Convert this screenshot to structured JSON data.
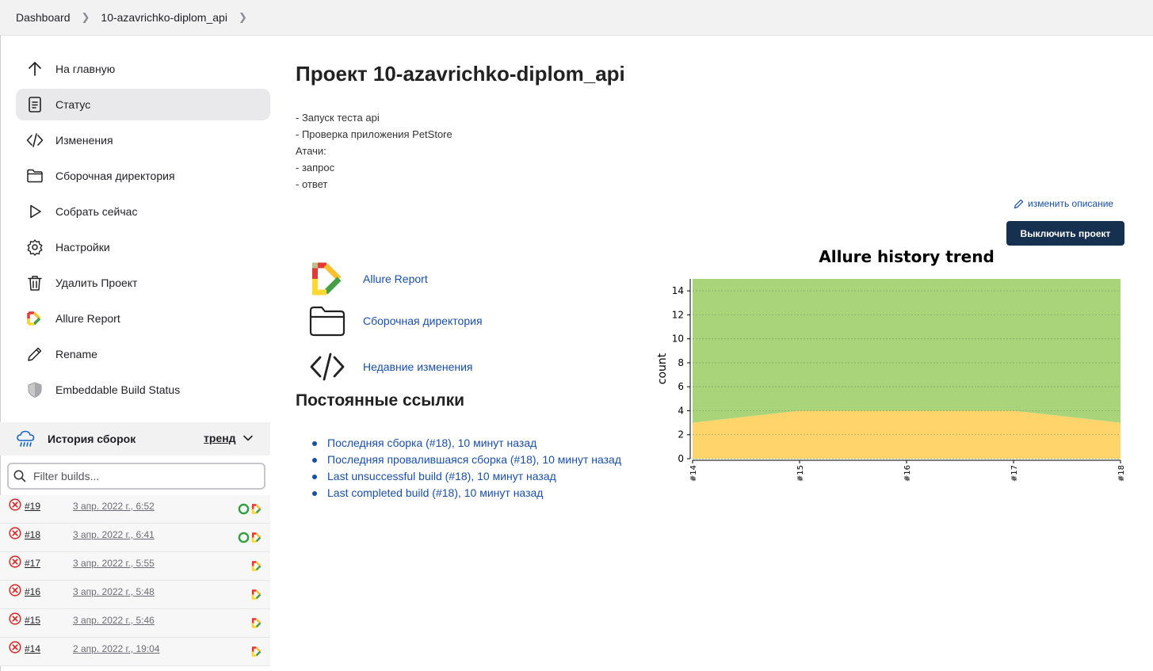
{
  "breadcrumb": [
    "Dashboard",
    "10-azavrichko-diplom_api"
  ],
  "sidebar": {
    "items": [
      {
        "label": "На главную",
        "icon": "arrow-up-icon",
        "active": false
      },
      {
        "label": "Статус",
        "icon": "document-icon",
        "active": true
      },
      {
        "label": "Изменения",
        "icon": "code-icon",
        "active": false
      },
      {
        "label": "Сборочная директория",
        "icon": "folder-icon",
        "active": false
      },
      {
        "label": "Собрать сейчас",
        "icon": "play-icon",
        "active": false
      },
      {
        "label": "Настройки",
        "icon": "gear-icon",
        "active": false
      },
      {
        "label": "Удалить Проект",
        "icon": "trash-icon",
        "active": false
      },
      {
        "label": "Allure Report",
        "icon": "allure-logo-icon",
        "active": false
      },
      {
        "label": "Rename",
        "icon": "pencil-icon",
        "active": false
      },
      {
        "label": "Embeddable Build Status",
        "icon": "shield-icon",
        "active": false
      }
    ]
  },
  "history": {
    "title": "История сборок",
    "trend_label": "тренд",
    "filter_placeholder": "Filter builds...",
    "builds": [
      {
        "number": "#19",
        "date": "3 апр. 2022 г., 6:52",
        "status": "failed",
        "badges": [
          "jacoco",
          "allure"
        ]
      },
      {
        "number": "#18",
        "date": "3 апр. 2022 г., 6:41",
        "status": "failed",
        "badges": [
          "jacoco",
          "allure"
        ]
      },
      {
        "number": "#17",
        "date": "3 апр. 2022 г., 5:55",
        "status": "failed",
        "badges": [
          "allure"
        ]
      },
      {
        "number": "#16",
        "date": "3 апр. 2022 г., 5:48",
        "status": "failed",
        "badges": [
          "allure"
        ]
      },
      {
        "number": "#15",
        "date": "3 апр. 2022 г., 5:46",
        "status": "failed",
        "badges": [
          "allure"
        ]
      },
      {
        "number": "#14",
        "date": "2 апр. 2022 г., 19:04",
        "status": "failed",
        "badges": [
          "allure"
        ]
      }
    ]
  },
  "main": {
    "title": "Проект 10-azavrichko-diplom_api",
    "description": [
      "- Запуск теста api",
      "- Проверка приложения PetStore",
      "Атачи:",
      "- запрос",
      "- ответ"
    ],
    "edit_description": "изменить описание",
    "disable_button": "Выключить проект",
    "links": [
      {
        "label": "Allure Report",
        "icon": "allure-logo-icon"
      },
      {
        "label": "Сборочная директория",
        "icon": "folder-icon"
      },
      {
        "label": "Недавние изменения",
        "icon": "code-icon"
      }
    ],
    "permalinks_title": "Постоянные ссылки",
    "permalinks": [
      "Последняя сборка (#18), 10 минут назад",
      "Последняя провалившаяся сборка (#18), 10 минут назад",
      "Last unsuccessful build (#18), 10 минут назад",
      "Last completed build (#18), 10 минут назад"
    ]
  },
  "chart_data": {
    "type": "area",
    "title": "Allure history trend",
    "xlabel": "",
    "ylabel": "count",
    "categories": [
      "#14",
      "#15",
      "#16",
      "#17",
      "#18"
    ],
    "ylim": [
      0,
      15
    ],
    "yticks": [
      0,
      2,
      4,
      6,
      8,
      10,
      12,
      14
    ],
    "grid": true,
    "stacked": true,
    "series": [
      {
        "values": [
          3,
          4,
          4,
          4,
          3
        ],
        "color": "#ffd56b"
      },
      {
        "values": [
          12,
          11,
          11,
          11,
          12
        ],
        "color": "#a9d47a"
      }
    ]
  }
}
